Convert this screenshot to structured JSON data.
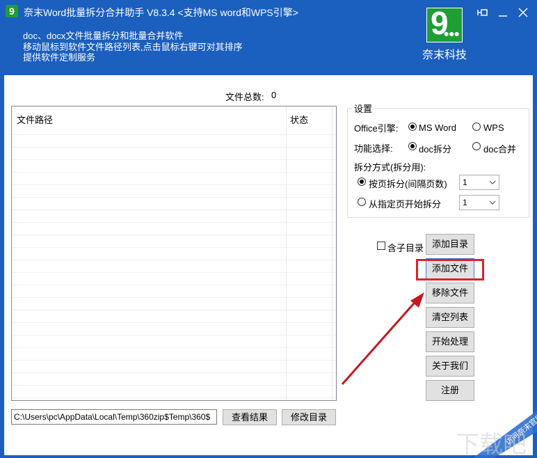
{
  "titlebar": {
    "title": "奈末Word批量拆分合并助手 V8.3.4 <支持MS word和WPS引擎>",
    "desc_lines": [
      "doc、docx文件批量拆分和批量合并软件",
      "移动鼠标到软件文件路径列表,点击鼠标右键可对其排序",
      "提供软件定制服务"
    ],
    "brand_name": "奈末科技",
    "logo_glyph": "9",
    "pin_icon": "⊣□",
    "minimize_icon": "—",
    "close_icon": "✕"
  },
  "file_count": {
    "label": "文件总数:",
    "value": "0"
  },
  "list": {
    "col_path": "文件路径",
    "col_status": "状态"
  },
  "path_input": {
    "value": "C:\\Users\\pc\\AppData\\Local\\Temp\\360zip$Temp\\360$"
  },
  "buttons": {
    "view_result": "查看结果",
    "change_dir": "修改目录",
    "add_dir": "添加目录",
    "add_file": "添加文件",
    "remove_file": "移除文件",
    "clear_list": "清空列表",
    "start": "开始处理",
    "about": "关于我们",
    "register": "注册"
  },
  "settings": {
    "legend": "设置",
    "engine_label": "Office引擎:",
    "engine_ms": "MS Word",
    "engine_wps": "WPS",
    "engine_selected": "MS Word",
    "func_label": "功能选择:",
    "func_split": "doc拆分",
    "func_merge": "doc合并",
    "func_selected": "doc拆分",
    "split_mode_label": "拆分方式(拆分用):",
    "split_by_page": "按页拆分(间隔页数)",
    "split_from_page": "从指定页开始拆分",
    "split_selected": "按页拆分(间隔页数)",
    "interval_value": "1",
    "start_page_value": "1"
  },
  "subdir": {
    "label": "含子目录",
    "checked": false
  },
  "colors": {
    "accent_blue": "#1b5fbf",
    "highlight_red": "#d9242a",
    "arrow_red": "#c8171e",
    "logo_green": "#1e9e34"
  }
}
